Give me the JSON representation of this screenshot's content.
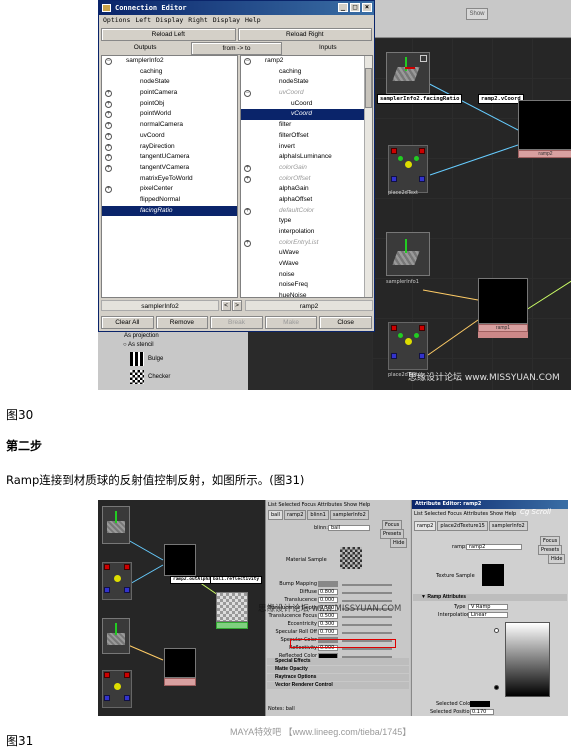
{
  "figure1": {
    "connection_editor": {
      "title": "Connection Editor",
      "menu": [
        "Options",
        "Left Display",
        "Right Display",
        "Help"
      ],
      "reload_left": "Reload Left",
      "reload_right": "Reload Right",
      "outputs": "Outputs",
      "direction": "from -> to",
      "inputs": "Inputs",
      "left_node": "samplerInfo2",
      "right_node": "ramp2",
      "left_items": [
        {
          "label": "samplerInfo2",
          "expand": "−",
          "indent": 0,
          "state": ""
        },
        {
          "label": "caching",
          "expand": "",
          "indent": 1,
          "state": ""
        },
        {
          "label": "nodeState",
          "expand": "",
          "indent": 1,
          "state": ""
        },
        {
          "label": "pointCamera",
          "expand": "+",
          "indent": 1,
          "state": ""
        },
        {
          "label": "pointObj",
          "expand": "+",
          "indent": 1,
          "state": ""
        },
        {
          "label": "pointWorld",
          "expand": "+",
          "indent": 1,
          "state": ""
        },
        {
          "label": "normalCamera",
          "expand": "+",
          "indent": 1,
          "state": ""
        },
        {
          "label": "uvCoord",
          "expand": "+",
          "indent": 1,
          "state": ""
        },
        {
          "label": "rayDirection",
          "expand": "+",
          "indent": 1,
          "state": ""
        },
        {
          "label": "tangentUCamera",
          "expand": "+",
          "indent": 1,
          "state": ""
        },
        {
          "label": "tangentVCamera",
          "expand": "+",
          "indent": 1,
          "state": ""
        },
        {
          "label": "matrixEyeToWorld",
          "expand": "",
          "indent": 1,
          "state": ""
        },
        {
          "label": "pixelCenter",
          "expand": "+",
          "indent": 1,
          "state": ""
        },
        {
          "label": "flippedNormal",
          "expand": "",
          "indent": 1,
          "state": ""
        },
        {
          "label": "facingRatio",
          "expand": "",
          "indent": 1,
          "state": "sel"
        }
      ],
      "right_items": [
        {
          "label": "ramp2",
          "expand": "−",
          "indent": 0,
          "state": ""
        },
        {
          "label": "caching",
          "expand": "",
          "indent": 1,
          "state": ""
        },
        {
          "label": "nodeState",
          "expand": "",
          "indent": 1,
          "state": ""
        },
        {
          "label": "uvCoord",
          "expand": "−",
          "indent": 1,
          "state": "grey"
        },
        {
          "label": "uCoord",
          "expand": "",
          "indent": 2,
          "state": ""
        },
        {
          "label": "vCoord",
          "expand": "",
          "indent": 2,
          "state": "sel"
        },
        {
          "label": "filter",
          "expand": "",
          "indent": 1,
          "state": ""
        },
        {
          "label": "filterOffset",
          "expand": "",
          "indent": 1,
          "state": ""
        },
        {
          "label": "invert",
          "expand": "",
          "indent": 1,
          "state": ""
        },
        {
          "label": "alphaIsLuminance",
          "expand": "",
          "indent": 1,
          "state": ""
        },
        {
          "label": "colorGain",
          "expand": "+",
          "indent": 1,
          "state": "grey"
        },
        {
          "label": "colorOffset",
          "expand": "+",
          "indent": 1,
          "state": "grey"
        },
        {
          "label": "alphaGain",
          "expand": "",
          "indent": 1,
          "state": ""
        },
        {
          "label": "alphaOffset",
          "expand": "",
          "indent": 1,
          "state": ""
        },
        {
          "label": "defaultColor",
          "expand": "+",
          "indent": 1,
          "state": "grey"
        },
        {
          "label": "type",
          "expand": "",
          "indent": 1,
          "state": ""
        },
        {
          "label": "interpolation",
          "expand": "",
          "indent": 1,
          "state": ""
        },
        {
          "label": "colorEntryList",
          "expand": "+",
          "indent": 1,
          "state": "grey"
        },
        {
          "label": "uWave",
          "expand": "",
          "indent": 1,
          "state": ""
        },
        {
          "label": "vWave",
          "expand": "",
          "indent": 1,
          "state": ""
        },
        {
          "label": "noise",
          "expand": "",
          "indent": 1,
          "state": ""
        },
        {
          "label": "noiseFreq",
          "expand": "",
          "indent": 1,
          "state": ""
        },
        {
          "label": "hueNoise",
          "expand": "",
          "indent": 1,
          "state": ""
        }
      ],
      "scroll_left": "<",
      "scroll_right": ">",
      "buttons": [
        "Clear All",
        "Remove",
        "Break",
        "Make",
        "Close"
      ]
    },
    "show_button": "Show",
    "hypershade": {
      "label_facing": "samplerInfo2.facingRatio",
      "label_vcoord": "ramp2.vCoord",
      "node_ramp2": "ramp2",
      "node_ramp1": "ramp1",
      "node_place2d_a": "place2dText",
      "node_sampler1": "samplerInfo1",
      "node_place2d_b": "place2dTextu"
    },
    "left_panel": {
      "items": [
        "As projection",
        "As stencil",
        "Bulge",
        "Checker"
      ]
    },
    "watermark": "思缘设计论坛  www.MISSYUAN.COM"
  },
  "caption30": "图30",
  "step_heading": "第二步",
  "body_text": "Ramp连接到材质球的反射值控制反射，如图所示。(图31)",
  "figure2": {
    "nodes": {
      "ramp_out": "ramp2.outAlpha",
      "refl": "bal1.reflectivity"
    },
    "middle_panel": {
      "menu": "List  Selected  Focus  Attributes  Show  Help",
      "tabs": [
        "ball",
        "ramp2",
        "blinn1",
        "samplerInfo2"
      ],
      "type_label": "blinn:",
      "type_value": "ball",
      "focus": "Focus",
      "presets": "Presets",
      "hide": "Hide",
      "material_sample": "Material Sample",
      "attrs": [
        {
          "label": "Bump Mapping",
          "value": ""
        },
        {
          "label": "Diffuse",
          "value": "0.800"
        },
        {
          "label": "Translucence",
          "value": "0.000"
        },
        {
          "label": "Translucence Depth",
          "value": "0.500"
        },
        {
          "label": "Translucence Focus",
          "value": "0.500"
        },
        {
          "label": "Eccentricity",
          "value": "0.300"
        },
        {
          "label": "Specular Roll Off",
          "value": "0.700"
        },
        {
          "label": "Specular Color",
          "value": ""
        },
        {
          "label": "Reflectivity",
          "value": "0.000"
        },
        {
          "label": "Reflected Color",
          "value": ""
        }
      ],
      "sections": [
        "Special Effects",
        "Matte Opacity",
        "Raytrace Options",
        "Vector Renderer Control"
      ],
      "notes": "Notes: ball"
    },
    "right_panel": {
      "title": "Attribute Editor: ramp2",
      "menu": "List  Selected  Focus  Attributes  Show  Help",
      "tabs": [
        "ramp2",
        "place2dTexture15",
        "samplerInfo2"
      ],
      "type_label": "ramp:",
      "type_value": "ramp2",
      "focus": "Focus",
      "presets": "Presets",
      "hide": "Hide",
      "texture_sample": "Texture Sample",
      "section": "Ramp Attributes",
      "type_field": "Type",
      "type_sel": "V Ramp",
      "interp_field": "Interpolation",
      "interp_sel": "Linear",
      "selected_color": "Selected Color",
      "selected_position": "Selected Position",
      "selected_position_value": "0.170"
    },
    "watermark": "思缘设计论坛  www.MISSYUAN.COM",
    "logo": "Cg Scroll"
  },
  "caption31": "图31",
  "footer": "MAYA特效吧  【www.lineeg.com/tieba/1745】",
  "colors": {
    "titlebar": "#0a246a",
    "selection": "#0a246a",
    "pink": "#d8a0a0",
    "green_node": "#7fd07f"
  }
}
